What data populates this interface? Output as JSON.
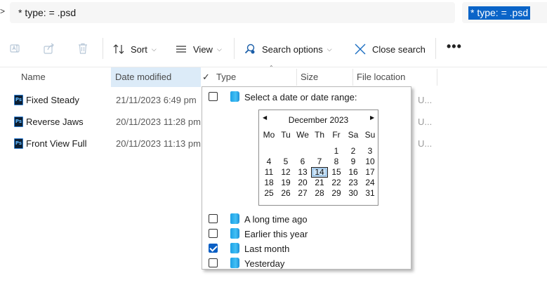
{
  "address": {
    "chevron": ">",
    "query": "* type: = .psd"
  },
  "search": {
    "selected_text": "* type: = .psd"
  },
  "toolbar": {
    "sort_label": "Sort",
    "view_label": "View",
    "search_options_label": "Search options",
    "close_search_label": "Close search",
    "more_label": "•••"
  },
  "columns": {
    "name": "Name",
    "date_modified": "Date modified",
    "type": "Type",
    "size": "Size",
    "file_location": "File location",
    "check": "✓"
  },
  "files": [
    {
      "name": "Fixed Steady",
      "date": "21/11/2023 6:49 pm",
      "location": "U..."
    },
    {
      "name": "Reverse Jaws",
      "date": "20/11/2023 11:28 pm",
      "location": "U..."
    },
    {
      "name": "Front View Full",
      "date": "20/11/2023 11:13 pm",
      "location": "U..."
    }
  ],
  "filter": {
    "date_option_label": "Select a date or date range:",
    "options": [
      {
        "label": "A long time ago",
        "checked": false
      },
      {
        "label": "Earlier this year",
        "checked": false
      },
      {
        "label": "Last month",
        "checked": true
      },
      {
        "label": "Yesterday",
        "checked": false
      }
    ]
  },
  "calendar": {
    "month_title": "December 2023",
    "prev_glyph": "◀",
    "next_glyph": "▶",
    "weekdays": [
      "Mo",
      "Tu",
      "We",
      "Th",
      "Fr",
      "Sa",
      "Su"
    ],
    "selected_day": "14",
    "weeks": [
      [
        "",
        "",
        "",
        "",
        "1",
        "2",
        "3"
      ],
      [
        "4",
        "5",
        "6",
        "7",
        "8",
        "9",
        "10"
      ],
      [
        "11",
        "12",
        "13",
        "14",
        "15",
        "16",
        "17"
      ],
      [
        "18",
        "19",
        "20",
        "21",
        "22",
        "23",
        "24"
      ],
      [
        "25",
        "26",
        "27",
        "28",
        "29",
        "30",
        "31"
      ]
    ]
  }
}
